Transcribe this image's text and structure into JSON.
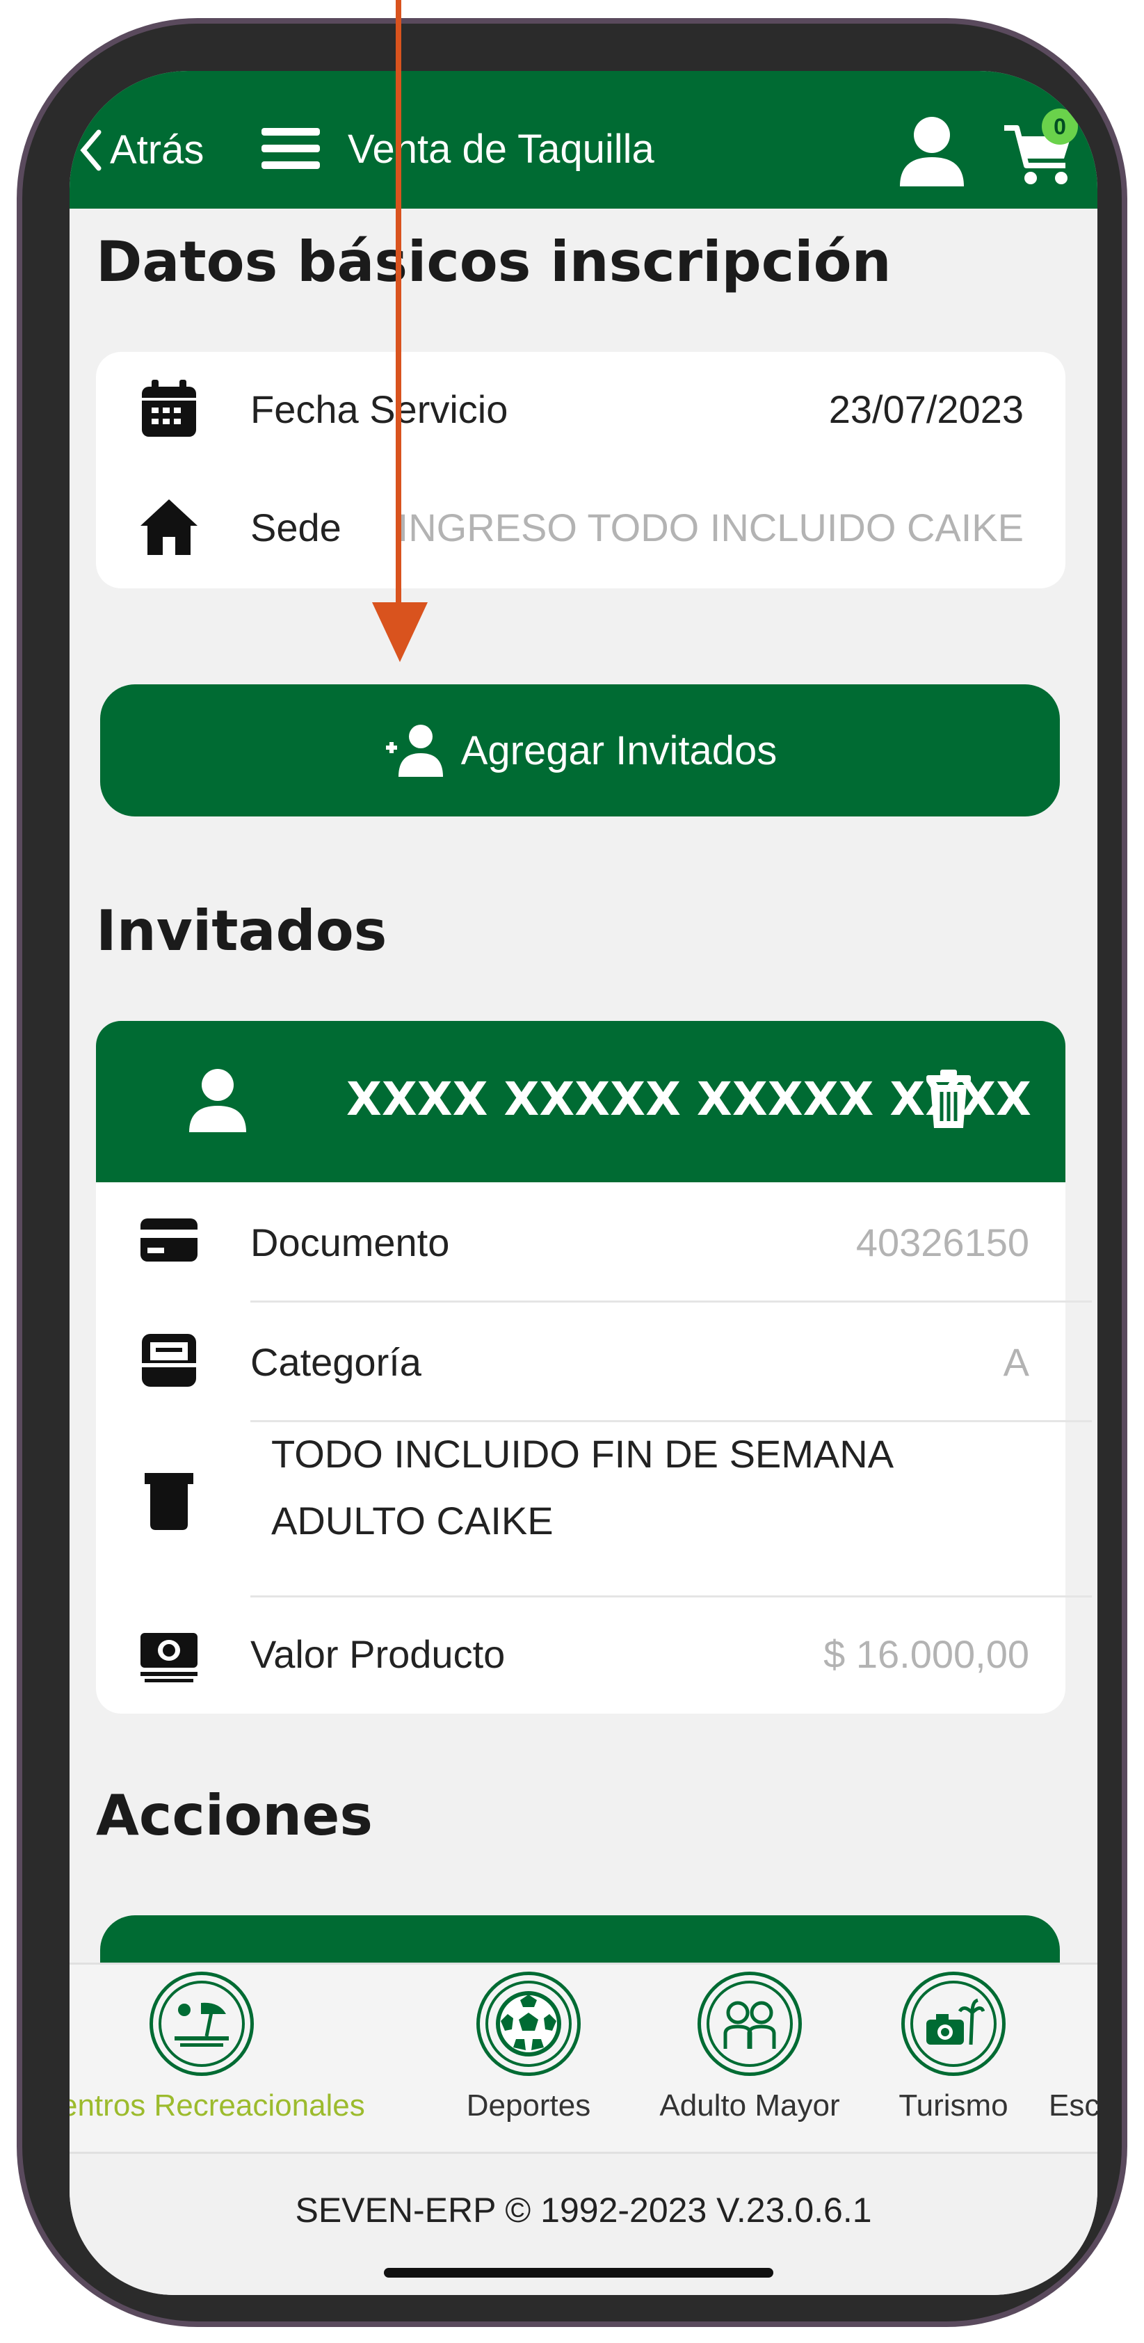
{
  "header": {
    "back_label": "Atrás",
    "title": "Venta de Taquilla",
    "cart_count": "0"
  },
  "basic": {
    "heading": "Datos básicos inscripción",
    "fecha_label": "Fecha Servicio",
    "fecha_value": "23/07/2023",
    "sede_label": "Sede",
    "sede_value": "INGRESO TODO INCLUIDO CAIKE"
  },
  "add_guests_label": "Agregar Invitados",
  "guests": {
    "heading": "Invitados",
    "name": "XXXX XXXXX XXXXX XXXX",
    "documento_label": "Documento",
    "documento_value": "40326150",
    "categoria_label": "Categoría",
    "categoria_value": "A",
    "producto_line1": "TODO INCLUIDO FIN DE SEMANA",
    "producto_line2": "ADULTO CAIKE",
    "valor_label": "Valor Producto",
    "valor_value": "$ 16.000,00"
  },
  "actions": {
    "heading": "Acciones"
  },
  "bottom_nav": [
    {
      "label": "Centros Recreacionales",
      "active": true
    },
    {
      "label": "Deportes",
      "active": false
    },
    {
      "label": "Adulto Mayor",
      "active": false
    },
    {
      "label": "Turismo",
      "active": false
    },
    {
      "label": "Esc",
      "active": false
    }
  ],
  "footer": {
    "text": "SEVEN-ERP © 1992-2023 V.23.0.6.1"
  },
  "colors": {
    "brand_green": "#006b33",
    "badge_green": "#6ad24b",
    "active_nav": "#9cbb2d",
    "annotation_arrow": "#d9531e"
  }
}
